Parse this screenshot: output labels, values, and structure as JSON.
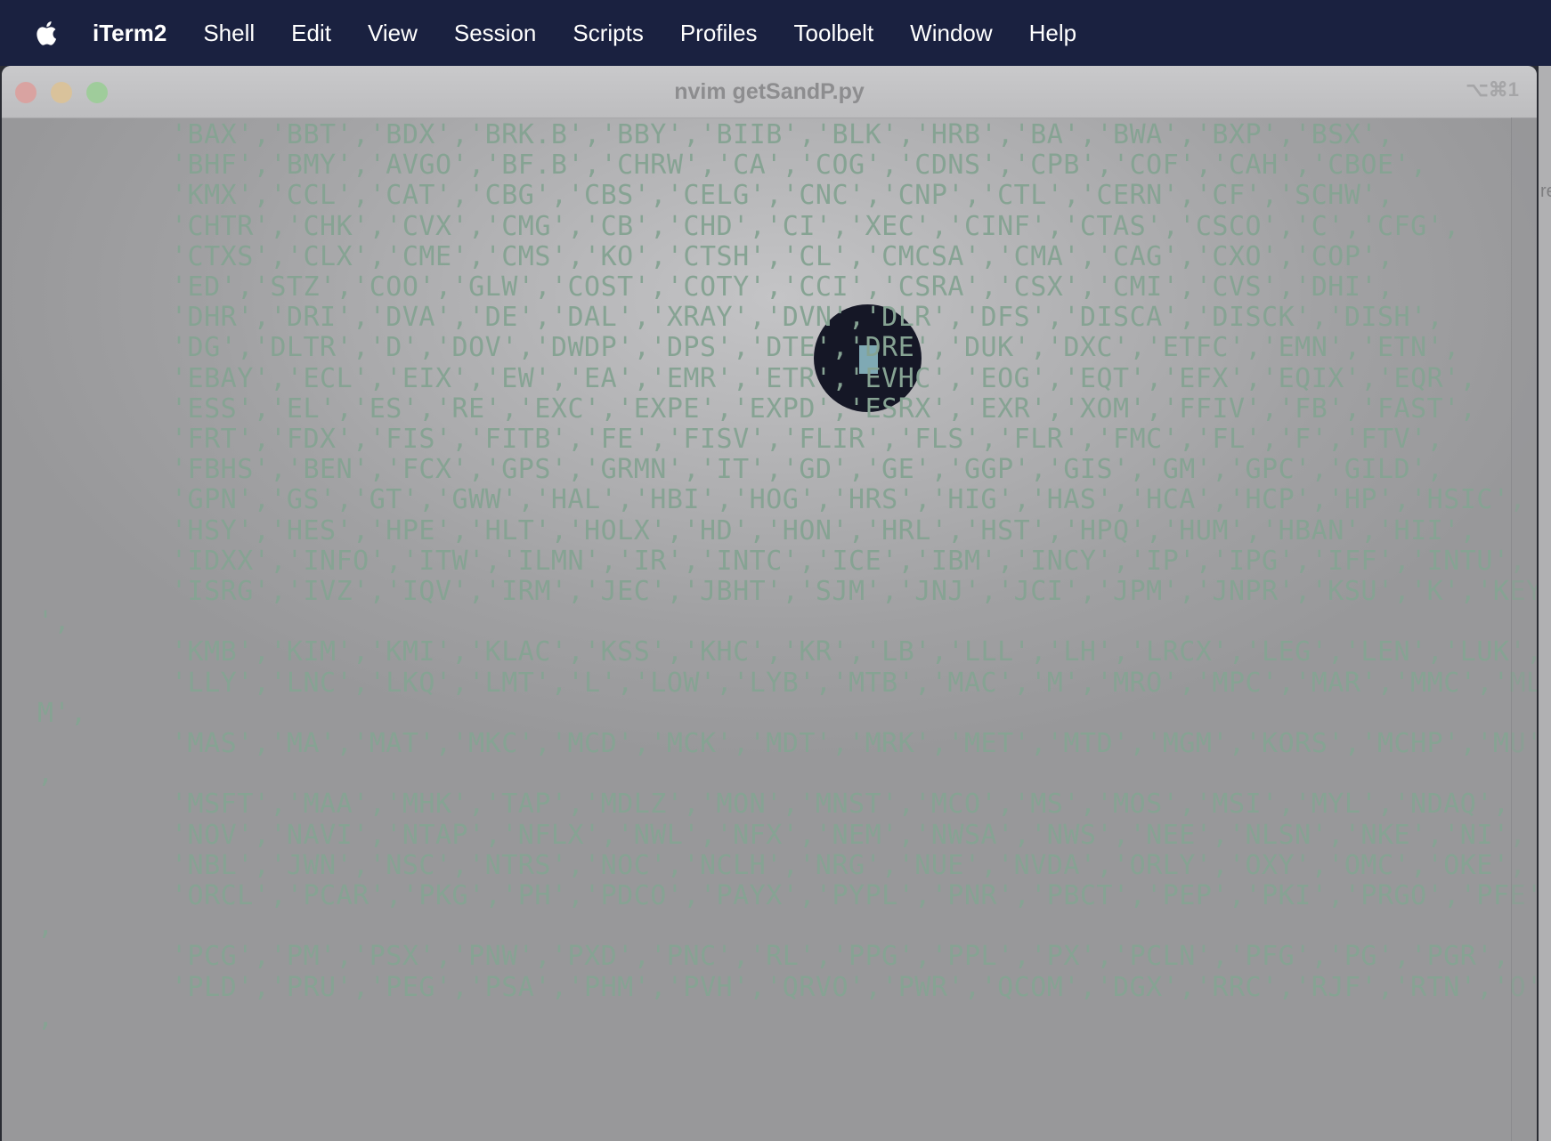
{
  "menubar": {
    "apple_icon": "apple-logo-icon",
    "items": [
      "iTerm2",
      "Shell",
      "Edit",
      "View",
      "Session",
      "Scripts",
      "Profiles",
      "Toolbelt",
      "Window",
      "Help"
    ]
  },
  "window": {
    "title": "nvim getSandP.py",
    "shortcut": "⌥⌘1",
    "side_glyph": "re",
    "colors": {
      "text": "#86a393",
      "cursor_circle": "#151726",
      "cursor_block": "#7fa9b4",
      "menubar": "#1a2140"
    }
  },
  "editor": {
    "lines": [
      "'BAX','BBT','BDX','BRK.B','BBY','BIIB','BLK','HRB','BA','BWA','BXP','BSX',",
      "'BHF','BMY','AVGO','BF.B','CHRW','CA','COG','CDNS','CPB','COF','CAH','CBOE',",
      "'KMX','CCL','CAT','CBG','CBS','CELG','CNC','CNP','CTL','CERN','CF','SCHW',",
      "'CHTR','CHK','CVX','CMG','CB','CHD','CI','XEC','CINF','CTAS','CSCO','C','CFG',",
      "'CTXS','CLX','CME','CMS','KO','CTSH','CL','CMCSA','CMA','CAG','CXO','COP',",
      "'ED','STZ','COO','GLW','COST','COTY','CCI','CSRA','CSX','CMI','CVS','DHI',",
      "'DHR','DRI','DVA','DE','DAL','XRAY','DVN','DLR','DFS','DISCA','DISCK','DISH',",
      "'DG','DLTR','D','DOV','DWDP','DPS','DTE','DRE','DUK','DXC','ETFC','EMN','ETN',",
      "'EBAY','ECL','EIX','EW','EA','EMR','ETR','EVHC','EOG','EQT','EFX','EQIX','EQR',",
      "'ESS','EL','ES','RE','EXC','EXPE','EXPD','ESRX','EXR','XOM','FFIV','FB','FAST',",
      "'FRT','FDX','FIS','FITB','FE','FISV','FLIR','FLS','FLR','FMC','FL','F','FTV',",
      "'FBHS','BEN','FCX','GPS','GRMN','IT','GD','GE','GGP','GIS','GM','GPC','GILD',",
      "'GPN','GS','GT','GWW','HAL','HBI','HOG','HRS','HIG','HAS','HCA','HCP','HP','HSIC',",
      "'HSY','HES','HPE','HLT','HOLX','HD','HON','HRL','HST','HPQ','HUM','HBAN','HII',",
      "'IDXX','INFO','ITW','ILMN','IR','INTC','ICE','IBM','INCY','IP','IPG','IFF','INTU',",
      "'ISRG','IVZ','IQV','IRM','JEC','JBHT','SJM','JNJ','JCI','JPM','JNPR','KSU','K','KEY",
      "',",
      "'KMB','KIM','KMI','KLAC','KSS','KHC','KR','LB','LLL','LH','LRCX','LEG','LEN','LUK',",
      "'LLY','LNC','LKQ','LMT','L','LOW','LYB','MTB','MAC','M','MRO','MPC','MAR','MMC','ML",
      "M',",
      "'MAS','MA','MAT','MKC','MCD','MCK','MDT','MRK','MET','MTD','MGM','KORS','MCHP','MU'",
      ",",
      "'MSFT','MAA','MHK','TAP','MDLZ','MON','MNST','MCO','MS','MOS','MSI','MYL','NDAQ',",
      "'NOV','NAVI','NTAP','NFLX','NWL','NFX','NEM','NWSA','NWS','NEE','NLSN','NKE','NI',",
      "'NBL','JWN','NSC','NTRS','NOC','NCLH','NRG','NUE','NVDA','ORLY','OXY','OMC','OKE',",
      "'ORCL','PCAR','PKG','PH','PDCO','PAYX','PYPL','PNR','PBCT','PEP','PKI','PRGO','PFE'",
      ",",
      "'PCG','PM','PSX','PNW','PXD','PNC','RL','PPG','PPL','PX','PCLN','PFG','PG','PGR',",
      "'PLD','PRU','PEG','PSA','PHM','PVH','QRVO','PWR','QCOM','DGX','RRC','RJF','RTN','O'",
      ","
    ]
  }
}
